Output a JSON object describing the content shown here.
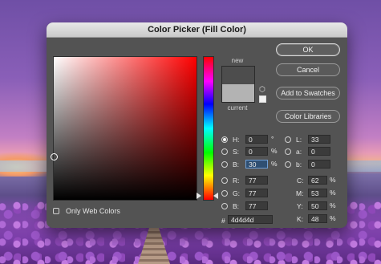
{
  "window": {
    "title": "Color Picker (Fill Color)"
  },
  "swatch": {
    "new_label": "new",
    "current_label": "current",
    "new_color": "#4d4d4d",
    "current_color": "#b3b3b3"
  },
  "buttons": {
    "ok": "OK",
    "cancel": "Cancel",
    "add_to_swatches": "Add to Swatches",
    "color_libraries": "Color Libraries"
  },
  "fields": {
    "H": {
      "label": "H:",
      "value": "0",
      "unit": "°"
    },
    "S": {
      "label": "S:",
      "value": "0",
      "unit": "%"
    },
    "B": {
      "label": "B:",
      "value": "30",
      "unit": "%"
    },
    "R": {
      "label": "R:",
      "value": "77"
    },
    "G": {
      "label": "G:",
      "value": "77"
    },
    "Bl": {
      "label": "B:",
      "value": "77"
    },
    "L": {
      "label": "L:",
      "value": "33"
    },
    "a": {
      "label": "a:",
      "value": "0"
    },
    "b": {
      "label": "b:",
      "value": "0"
    },
    "C": {
      "label": "C:",
      "value": "62",
      "unit": "%"
    },
    "M": {
      "label": "M:",
      "value": "53",
      "unit": "%"
    },
    "Y": {
      "label": "Y:",
      "value": "50",
      "unit": "%"
    },
    "K": {
      "label": "K:",
      "value": "48",
      "unit": "%"
    },
    "hex": {
      "label": "#",
      "value": "4d4d4d"
    }
  },
  "options": {
    "only_web_colors": "Only Web Colors"
  },
  "icons": {
    "gamut": "cube-icon",
    "websafe": "websafe-square-icon"
  }
}
